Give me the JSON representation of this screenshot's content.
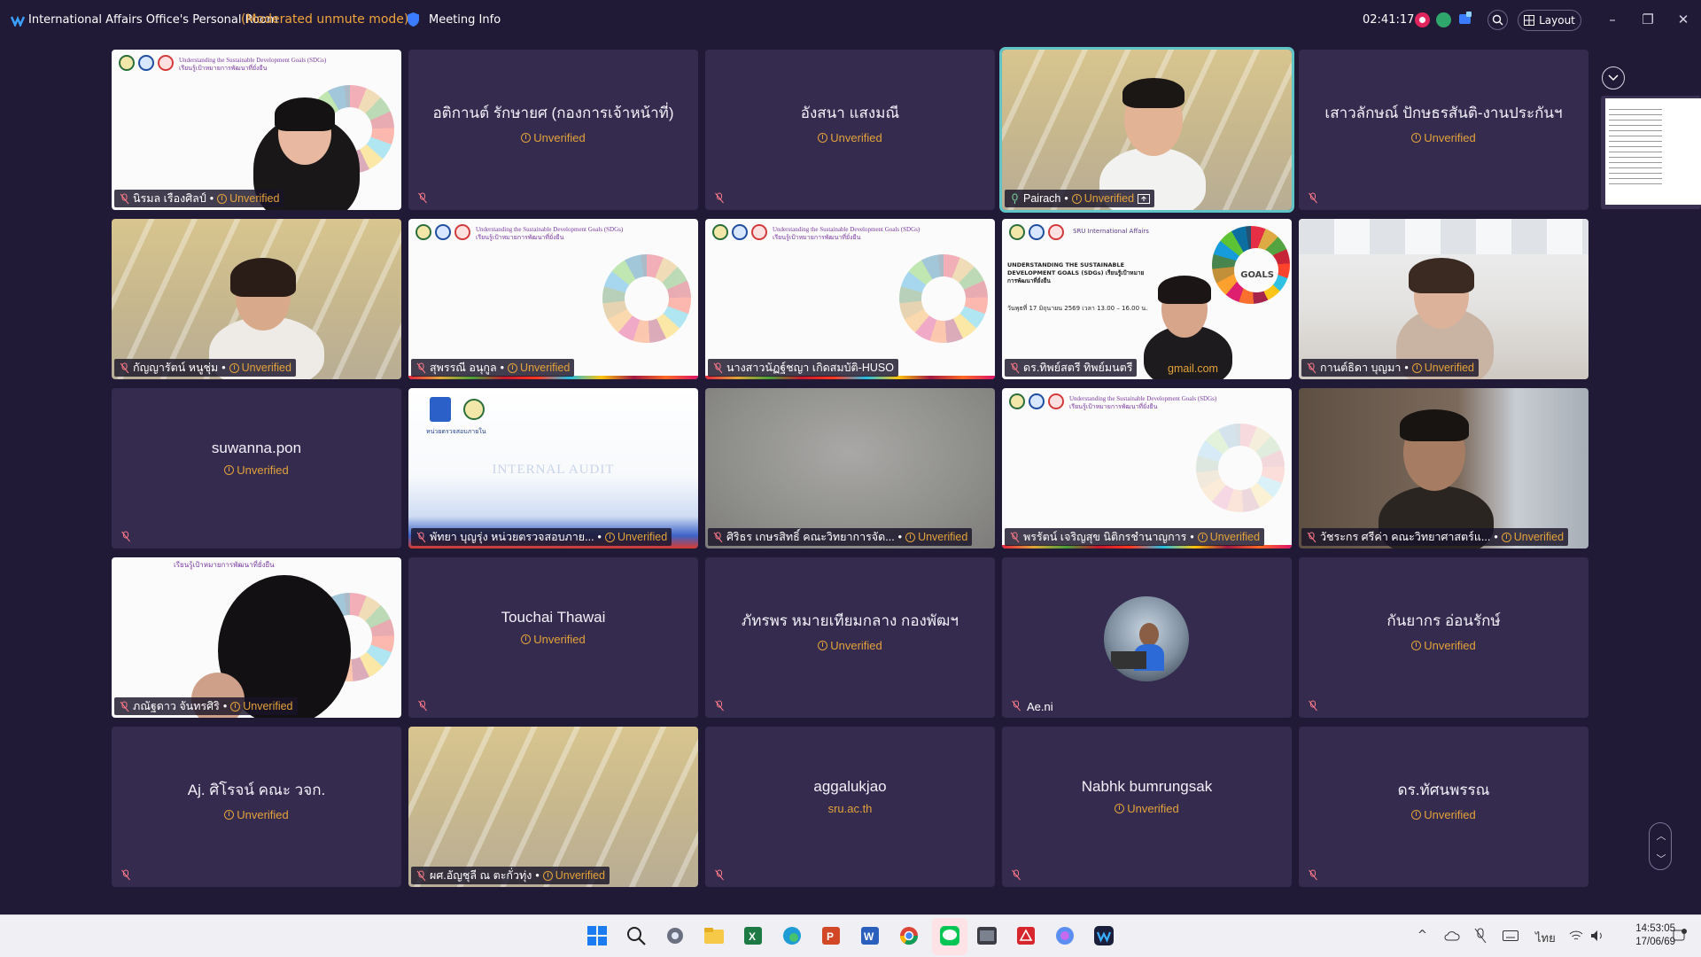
{
  "titlebar": {
    "room_title": "International Affairs Office's Personal Room",
    "mode": "(Moderated unmute mode)",
    "meeting_info": "Meeting Info",
    "timer": "02:41:17",
    "layout_label": "Layout"
  },
  "unverified_label": "Unverified",
  "tiles": [
    {
      "name": "นิรมล เรืองศิลป์",
      "label": "นิรมล เรืองศิลป์",
      "unverified": "Unverified",
      "type": "video"
    },
    {
      "name": "อติกานต์ รักษายศ (กองการเจ้าหน้าที่)",
      "unverified": "Unverified",
      "type": "avatar"
    },
    {
      "name": "อังสนา แสงมณี",
      "unverified": "Unverified",
      "type": "avatar"
    },
    {
      "name": "Pairach",
      "label": "Pairach",
      "unverified": "Unverified",
      "type": "video"
    },
    {
      "name": "เสาวลักษณ์ ปักษธรสันติ-งานประกันฯ",
      "unverified": "Unverified",
      "type": "avatar"
    },
    {
      "name": "กัญญารัตน์ หนูชุ่ม",
      "label": "กัญญารัตน์  หนูชุ่ม",
      "unverified": "Unverified",
      "type": "video"
    },
    {
      "name": "สุพรรณี อนุกูล",
      "label": "สุพรรณี อนุกูล",
      "unverified": "Unverified",
      "type": "video"
    },
    {
      "name": "นางสาวนัฏฐ์ชญา เกิดสมบัติ-HUSO",
      "label": "นางสาวนัฏฐ์ชญา เกิดสมบัติ-HUSO",
      "type": "video"
    },
    {
      "name": "ดร.ทิพย์สตรี ทิพย์มนตรี",
      "label": "ดร.ทิพย์สตรี ทิพย์มนตรี",
      "email_suffix": "gmail.com",
      "type": "video"
    },
    {
      "name": "กานต์ธิดา บุญมา",
      "label": "กานต์ธิดา บุญมา",
      "unverified": "Unverified",
      "type": "video"
    },
    {
      "name": "suwanna.pon",
      "unverified": "Unverified",
      "type": "avatar"
    },
    {
      "name": "พัทยา บุญรุ่ง หน่วยตรวจสอบภายใน",
      "label": "พัทยา บุญรุ่ง หน่วยตรวจสอบภาย...",
      "unverified": "Unverified",
      "type": "video",
      "slide_text": "INTERNAL AUDIT",
      "slide_subtitle": "หน่วยตรวจสอบภายใน"
    },
    {
      "name": "ศิริธร เกษรสิทธิ์ คณะวิทยาการจัดการ",
      "label": "ศิริธร เกษรสิทธิ์ คณะวิทยาการจัด...",
      "unverified": "Unverified",
      "type": "video"
    },
    {
      "name": "พรรัตน์ เจริญสุข นิติกรชำนาญการ",
      "label": "พรรัตน์ เจริญสุข นิติกรชำนาญการ",
      "unverified": "Unverified",
      "type": "video"
    },
    {
      "name": "วัชระกร ศรีค่า คณะวิทยาศาสตร์และเทคโนโลยี",
      "label": "วัชระกร ศรีค่า คณะวิทยาศาสตร์แ...",
      "unverified": "Unverified",
      "type": "video"
    },
    {
      "name": "ภณัฐดาว จันทรศิริ",
      "label": "ภณัฐดาว จันทรศิริ",
      "unverified": "Unverified",
      "type": "video"
    },
    {
      "name": "Touchai Thawai",
      "unverified": "Unverified",
      "type": "avatar"
    },
    {
      "name": "ภัทรพร หมายเทียมกลาง กองพัฒฯ",
      "unverified": "Unverified",
      "type": "avatar"
    },
    {
      "name": "Ae.ni",
      "label": "Ae.ni",
      "type": "photo"
    },
    {
      "name": "กันยากร อ่อนรักษ์",
      "unverified": "Unverified",
      "type": "avatar"
    },
    {
      "name": "Aj. ศิโรจน์ คณะ วจก.",
      "unverified": "Unverified",
      "type": "avatar"
    },
    {
      "name": "ผศ.อัญชุลี ณ ตะกั่วทุ่ง",
      "label": "ผศ.อัญชุลี ณ ตะกั่วทุ่ง",
      "unverified": "Unverified",
      "type": "video"
    },
    {
      "name": "aggalukjao",
      "subtitle": "sru.ac.th",
      "type": "avatar"
    },
    {
      "name": "Nabhk bumrungsak",
      "unverified": "Unverified",
      "type": "avatar"
    },
    {
      "name": "ดร.ทัศนพรรณ",
      "unverified": "Unverified",
      "type": "avatar"
    }
  ],
  "slide": {
    "title_en": "Understanding the Sustainable Development Goals (SDGs)",
    "title_th": "เรียนรู้เป้าหมายการพัฒนาที่ยั่งยืน",
    "webinar_title": "UNDERSTANDING THE SUSTAINABLE DEVELOPMENT GOALS (SDGs) เรียนรู้เป้าหมายการพัฒนาที่ยั่งยืน",
    "webinar_date": "วันพุธที่ 17 มิถุนายน 2569  เวลา 13.00 – 16.00 น.",
    "org": "SRU International Affairs",
    "goals": "GOALS"
  },
  "taskbar": {
    "apps": [
      "start-icon",
      "search-icon",
      "settings-icon",
      "file-explorer-icon",
      "excel-icon",
      "edge-icon",
      "powerpoint-icon",
      "word-icon",
      "chrome-icon",
      "line-icon",
      "terminal-icon",
      "acrobat-icon",
      "copilot-icon",
      "webex-icon"
    ],
    "time": "14:53:05",
    "date": "17/06/69",
    "lang": "ไทย"
  },
  "colors": {
    "background": "#211a37",
    "tile": "#342b4e",
    "unverified": "#e4a23a",
    "active_border": "#5fc4c6",
    "mode_label": "#f0a43a"
  }
}
